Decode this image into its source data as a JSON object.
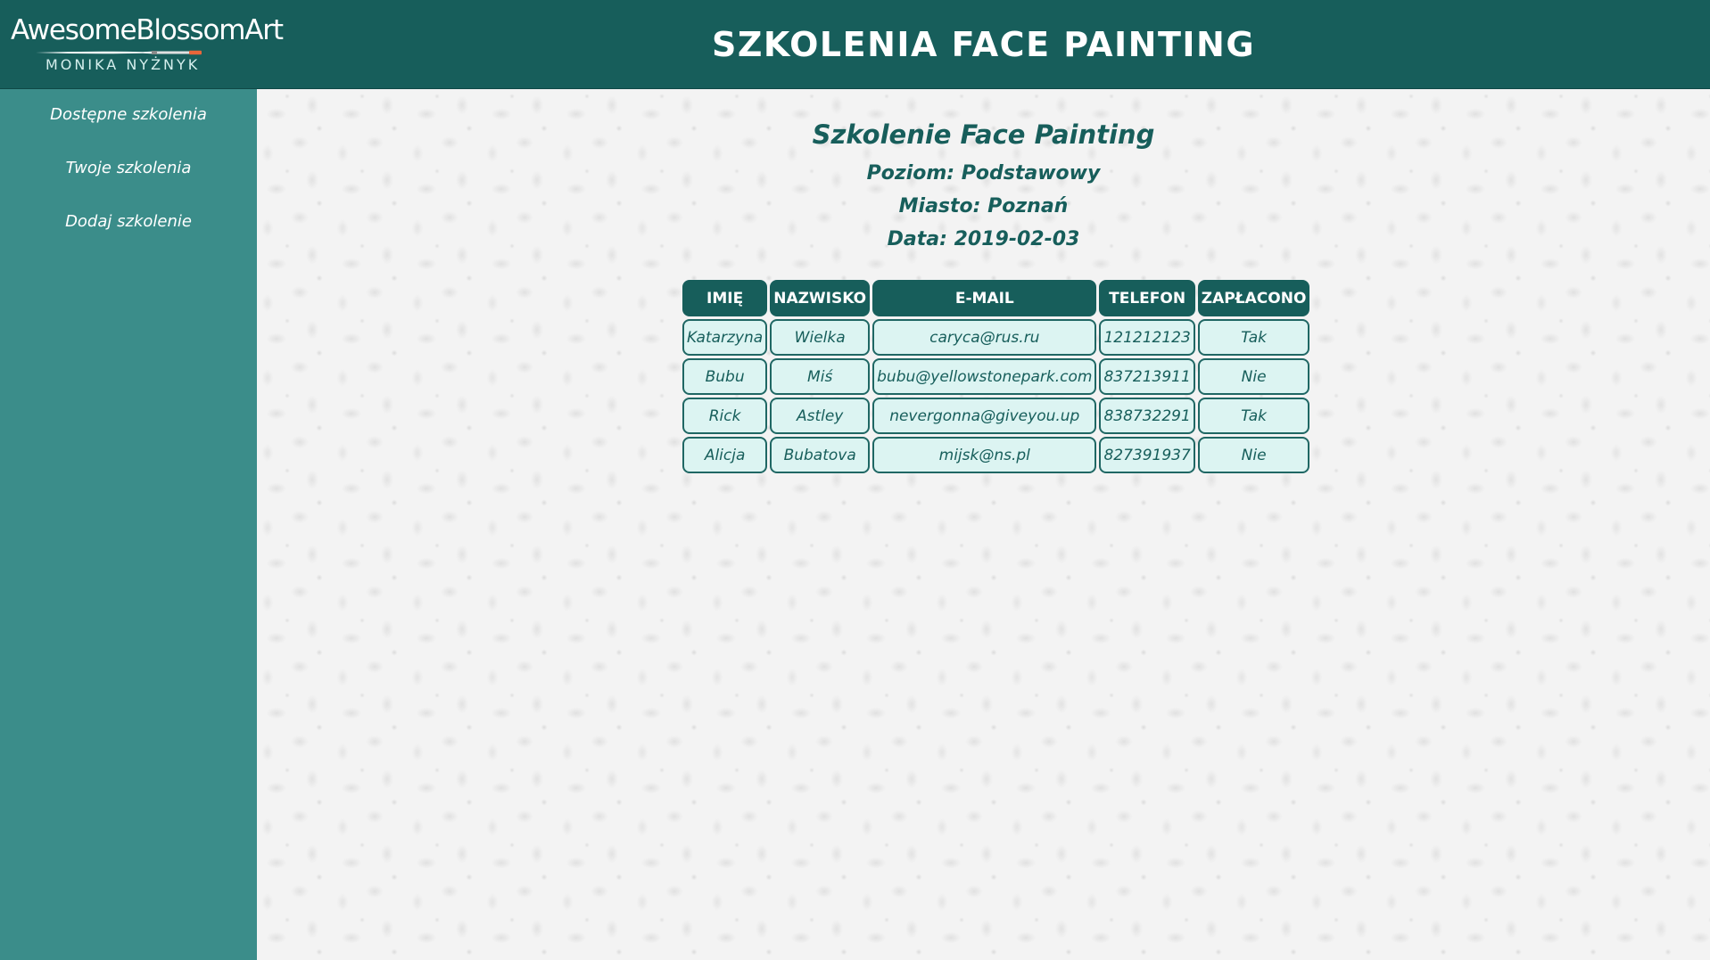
{
  "header": {
    "logo_main": "AwesomeBlossomArt",
    "logo_sub": "MONIKA NYŻNYK",
    "title": "SZKOLENIA FACE PAINTING"
  },
  "sidebar": {
    "items": [
      {
        "label": "Dostępne szkolenia"
      },
      {
        "label": "Twoje szkolenia"
      },
      {
        "label": "Dodaj szkolenie"
      }
    ]
  },
  "course": {
    "title": "Szkolenie Face Painting",
    "level": "Poziom: Podstawowy",
    "city": "Miasto: Poznań",
    "date": "Data: 2019-02-03"
  },
  "table": {
    "headers": [
      "IMIĘ",
      "NAZWISKO",
      "E-MAIL",
      "TELEFON",
      "ZAPŁACONO"
    ],
    "rows": [
      [
        "Katarzyna",
        "Wielka",
        "caryca@rus.ru",
        "121212123",
        "Tak"
      ],
      [
        "Bubu",
        "Miś",
        "bubu@yellowstonepark.com",
        "837213911",
        "Nie"
      ],
      [
        "Rick",
        "Astley",
        "nevergonna@giveyou.up",
        "838732291",
        "Tak"
      ],
      [
        "Alicja",
        "Bubatova",
        "mijsk@ns.pl",
        "827391937",
        "Nie"
      ]
    ]
  },
  "colors": {
    "header_bg": "#175e5b",
    "sidebar_bg": "#3b8d8a",
    "cell_bg": "#dcf4f2",
    "accent_text": "#175e5b"
  }
}
